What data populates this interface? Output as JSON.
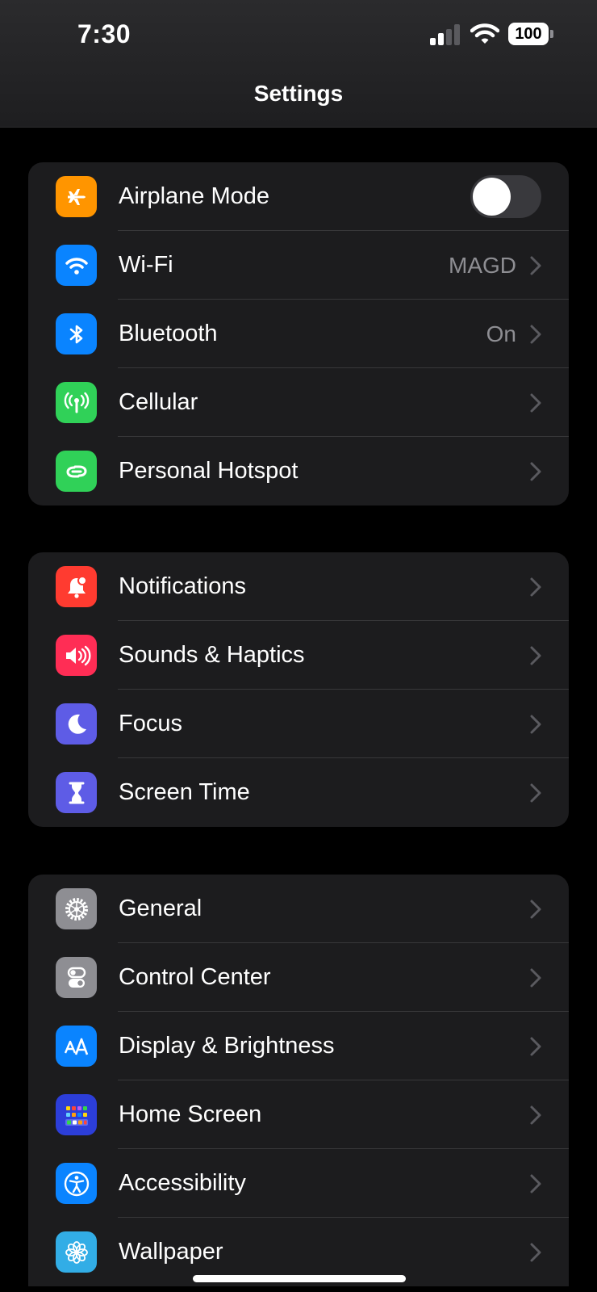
{
  "status_bar": {
    "time": "7:30",
    "battery": "100"
  },
  "nav": {
    "title": "Settings"
  },
  "groups": [
    {
      "items": [
        {
          "label": "Airplane Mode",
          "icon": "airplane-icon",
          "color": "#ff9500",
          "toggle": "off"
        },
        {
          "label": "Wi-Fi",
          "icon": "wifi-icon",
          "color": "#0a84ff",
          "value": "MAGD"
        },
        {
          "label": "Bluetooth",
          "icon": "bluetooth-icon",
          "color": "#0a84ff",
          "value": "On"
        },
        {
          "label": "Cellular",
          "icon": "antenna-icon",
          "color": "#30d158"
        },
        {
          "label": "Personal Hotspot",
          "icon": "hotspot-icon",
          "color": "#30d158"
        }
      ]
    },
    {
      "items": [
        {
          "label": "Notifications",
          "icon": "bell-icon",
          "color": "#ff3b30"
        },
        {
          "label": "Sounds & Haptics",
          "icon": "speaker-icon",
          "color": "#ff2d55"
        },
        {
          "label": "Focus",
          "icon": "moon-icon",
          "color": "#5e5ce6"
        },
        {
          "label": "Screen Time",
          "icon": "hourglass-icon",
          "color": "#5e5ce6"
        }
      ]
    },
    {
      "items": [
        {
          "label": "General",
          "icon": "gear-icon",
          "color": "#8e8e93"
        },
        {
          "label": "Control Center",
          "icon": "switches-icon",
          "color": "#8e8e93"
        },
        {
          "label": "Display & Brightness",
          "icon": "text-size-icon",
          "color": "#0a84ff"
        },
        {
          "label": "Home Screen",
          "icon": "app-grid-icon",
          "color": "#2c3ed9"
        },
        {
          "label": "Accessibility",
          "icon": "accessibility-icon",
          "color": "#0a84ff"
        },
        {
          "label": "Wallpaper",
          "icon": "flower-icon",
          "color": "#32ade6"
        }
      ]
    }
  ]
}
